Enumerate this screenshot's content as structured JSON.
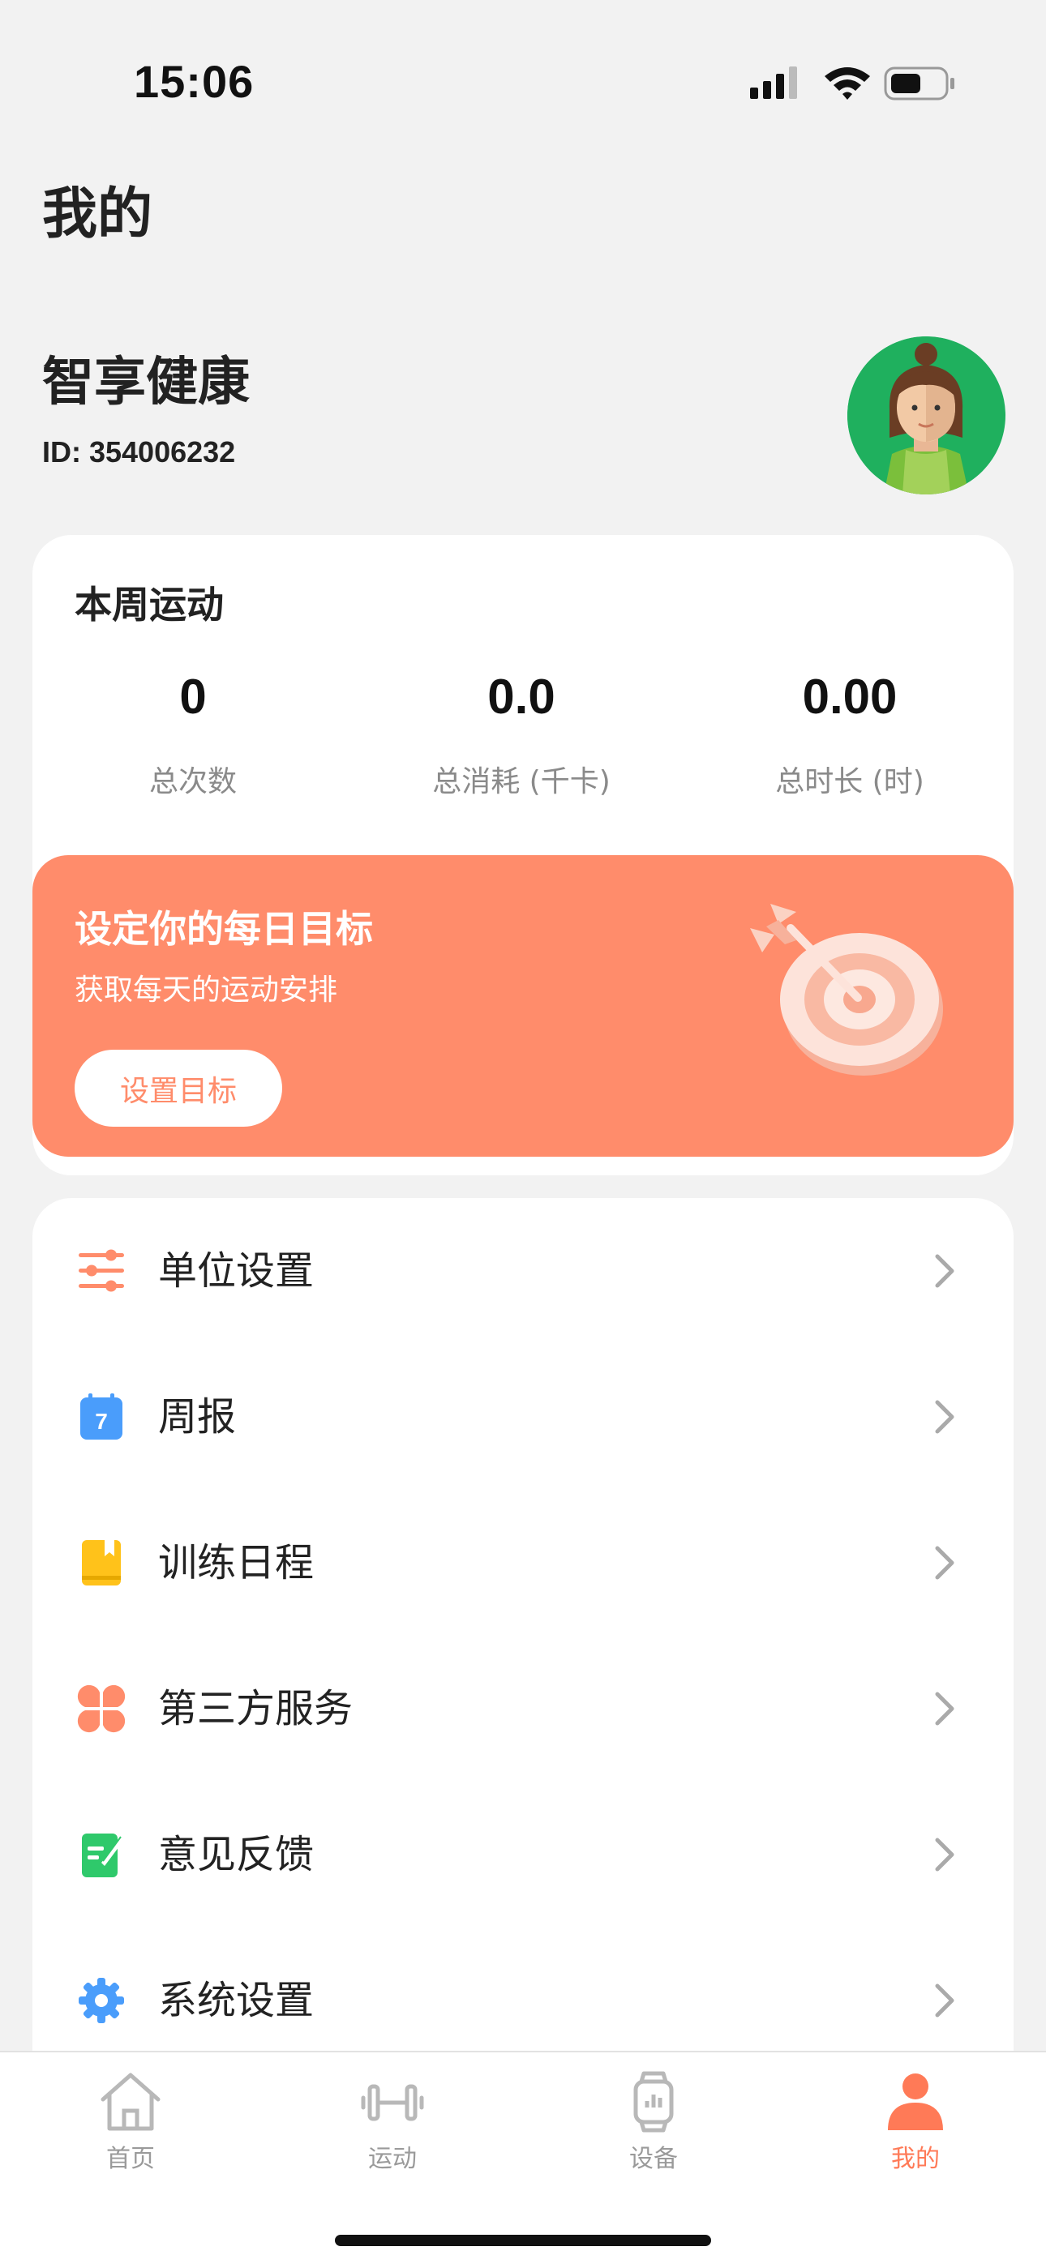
{
  "status_bar": {
    "time": "15:06"
  },
  "page": {
    "title": "我的"
  },
  "profile": {
    "name": "智享健康",
    "id_text": "ID: 354006232"
  },
  "weekly_stats": {
    "title": "本周运动",
    "items": [
      {
        "value": "0",
        "label": "总次数"
      },
      {
        "value": "0.0",
        "label": "总消耗 (千卡)"
      },
      {
        "value": "0.00",
        "label": "总时长 (时)"
      }
    ]
  },
  "goal_banner": {
    "title": "设定你的每日目标",
    "subtitle": "获取每天的运动安排",
    "button_label": "设置目标",
    "color": "#ff8c6b"
  },
  "menu": {
    "items": [
      {
        "label": "单位设置",
        "icon": "sliders-icon",
        "color": "#ff8c6b"
      },
      {
        "label": "周报",
        "icon": "calendar-icon",
        "color": "#4a9dfb",
        "badge": "7"
      },
      {
        "label": "训练日程",
        "icon": "book-icon",
        "color": "#ffc21a"
      },
      {
        "label": "第三方服务",
        "icon": "clover-icon",
        "color": "#ff8c6b"
      },
      {
        "label": "意见反馈",
        "icon": "feedback-icon",
        "color": "#2fc96b"
      },
      {
        "label": "系统设置",
        "icon": "gear-icon",
        "color": "#4a9dfb"
      }
    ]
  },
  "tab_bar": {
    "tabs": [
      {
        "label": "首页",
        "icon": "home-icon",
        "active": false
      },
      {
        "label": "运动",
        "icon": "dumbbell-icon",
        "active": false
      },
      {
        "label": "设备",
        "icon": "watch-icon",
        "active": false
      },
      {
        "label": "我的",
        "icon": "person-icon",
        "active": true
      }
    ],
    "active_color": "#ff7a57",
    "inactive_color": "#9a9a9a"
  }
}
